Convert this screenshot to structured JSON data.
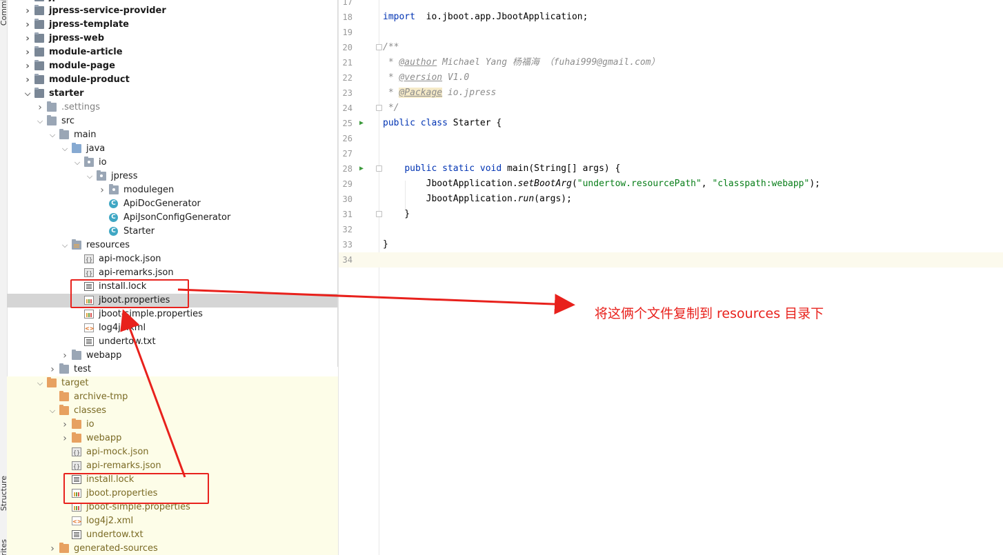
{
  "side_tabs": {
    "commit": "Commit",
    "structure": "Structure",
    "favorites": "Favorites"
  },
  "tree": [
    {
      "label": "jpress-service",
      "kind": "module",
      "icon": "module-folder-icon",
      "arrow": "right",
      "depth": 1
    },
    {
      "label": "jpress-service-provider",
      "kind": "module",
      "icon": "module-folder-icon",
      "arrow": "right",
      "depth": 1
    },
    {
      "label": "jpress-template",
      "kind": "module",
      "icon": "module-folder-icon",
      "arrow": "right",
      "depth": 1
    },
    {
      "label": "jpress-web",
      "kind": "module",
      "icon": "module-folder-icon",
      "arrow": "right",
      "depth": 1
    },
    {
      "label": "module-article",
      "kind": "module",
      "icon": "module-folder-icon",
      "arrow": "right",
      "depth": 1
    },
    {
      "label": "module-page",
      "kind": "module",
      "icon": "module-folder-icon",
      "arrow": "right",
      "depth": 1
    },
    {
      "label": "module-product",
      "kind": "module",
      "icon": "module-folder-icon",
      "arrow": "right",
      "depth": 1
    },
    {
      "label": "starter",
      "kind": "module",
      "icon": "module-folder-icon",
      "arrow": "down",
      "depth": 1
    },
    {
      "label": ".settings",
      "kind": "dim",
      "icon": "folder-icon",
      "arrow": "right",
      "depth": 2
    },
    {
      "label": "src",
      "kind": "normal",
      "icon": "folder-icon",
      "arrow": "down",
      "depth": 2
    },
    {
      "label": "main",
      "kind": "normal",
      "icon": "folder-icon",
      "arrow": "down",
      "depth": 3
    },
    {
      "label": "java",
      "kind": "normal",
      "icon": "source-folder-icon",
      "arrow": "down",
      "depth": 4
    },
    {
      "label": "io",
      "kind": "normal",
      "icon": "package-icon",
      "arrow": "down",
      "depth": 5
    },
    {
      "label": "jpress",
      "kind": "normal",
      "icon": "package-icon",
      "arrow": "down",
      "depth": 6
    },
    {
      "label": "modulegen",
      "kind": "normal",
      "icon": "package-icon",
      "arrow": "right",
      "depth": 7
    },
    {
      "label": "ApiDocGenerator",
      "kind": "normal",
      "icon": "class-icon",
      "arrow": "",
      "depth": 7
    },
    {
      "label": "ApiJsonConfigGenerator",
      "kind": "normal",
      "icon": "class-icon",
      "arrow": "",
      "depth": 7
    },
    {
      "label": "Starter",
      "kind": "normal",
      "icon": "class-icon",
      "arrow": "",
      "depth": 7
    },
    {
      "label": "resources",
      "kind": "normal",
      "icon": "resources-folder-icon",
      "arrow": "down",
      "depth": 4
    },
    {
      "label": "api-mock.json",
      "kind": "normal",
      "icon": "json-file-icon",
      "arrow": "",
      "depth": 5
    },
    {
      "label": "api-remarks.json",
      "kind": "normal",
      "icon": "json-file-icon",
      "arrow": "",
      "depth": 5
    },
    {
      "label": "install.lock",
      "kind": "normal",
      "icon": "text-file-icon",
      "arrow": "",
      "depth": 5
    },
    {
      "label": "jboot.properties",
      "kind": "selected",
      "icon": "properties-file-icon",
      "arrow": "",
      "depth": 5
    },
    {
      "label": "jboot-simple.properties",
      "kind": "normal",
      "icon": "properties-file-icon",
      "arrow": "",
      "depth": 5
    },
    {
      "label": "log4j2.xml",
      "kind": "normal",
      "icon": "xml-file-icon",
      "arrow": "",
      "depth": 5
    },
    {
      "label": "undertow.txt",
      "kind": "normal",
      "icon": "text-file-icon",
      "arrow": "",
      "depth": 5
    },
    {
      "label": "webapp",
      "kind": "normal",
      "icon": "folder-icon",
      "arrow": "right",
      "depth": 4
    },
    {
      "label": "test",
      "kind": "normal",
      "icon": "folder-icon",
      "arrow": "right",
      "depth": 3
    },
    {
      "label": "target",
      "kind": "excluded",
      "icon": "excluded-folder-icon",
      "arrow": "down",
      "depth": 2
    },
    {
      "label": "archive-tmp",
      "kind": "excluded",
      "icon": "excluded-folder-icon",
      "arrow": "",
      "depth": 3
    },
    {
      "label": "classes",
      "kind": "excluded",
      "icon": "excluded-folder-icon",
      "arrow": "down",
      "depth": 3
    },
    {
      "label": "io",
      "kind": "excluded",
      "icon": "excluded-folder-icon",
      "arrow": "right",
      "depth": 4
    },
    {
      "label": "webapp",
      "kind": "excluded",
      "icon": "excluded-folder-icon",
      "arrow": "right",
      "depth": 4
    },
    {
      "label": "api-mock.json",
      "kind": "excluded",
      "icon": "json-file-icon",
      "arrow": "",
      "depth": 4
    },
    {
      "label": "api-remarks.json",
      "kind": "excluded",
      "icon": "json-file-icon",
      "arrow": "",
      "depth": 4
    },
    {
      "label": "install.lock",
      "kind": "excluded",
      "icon": "text-file-icon",
      "arrow": "",
      "depth": 4
    },
    {
      "label": "jboot.properties",
      "kind": "excluded",
      "icon": "properties-file-icon",
      "arrow": "",
      "depth": 4
    },
    {
      "label": "jboot-simple.properties",
      "kind": "excluded",
      "icon": "properties-file-icon",
      "arrow": "",
      "depth": 4
    },
    {
      "label": "log4j2.xml",
      "kind": "excluded",
      "icon": "xml-file-icon",
      "arrow": "",
      "depth": 4
    },
    {
      "label": "undertow.txt",
      "kind": "excluded",
      "icon": "text-file-icon",
      "arrow": "",
      "depth": 4
    },
    {
      "label": "generated-sources",
      "kind": "excluded",
      "icon": "excluded-folder-icon",
      "arrow": "right",
      "depth": 3
    }
  ],
  "editor": {
    "lines": [
      {
        "n": "17",
        "segs": []
      },
      {
        "n": "18",
        "segs": [
          [
            "kw",
            "import"
          ],
          [
            "",
            "  io.jboot.app.JbootApplication;"
          ]
        ]
      },
      {
        "n": "19",
        "segs": []
      },
      {
        "n": "20",
        "segs": [
          [
            "cm",
            "/**"
          ]
        ],
        "fold": true
      },
      {
        "n": "21",
        "segs": [
          [
            "cm",
            " * "
          ],
          [
            "tag",
            "@author"
          ],
          [
            "cm",
            " Michael Yang 杨福海 （fuhai999@gmail.com）"
          ]
        ]
      },
      {
        "n": "22",
        "segs": [
          [
            "cm",
            " * "
          ],
          [
            "tag",
            "@version"
          ],
          [
            "cm",
            " V1.0"
          ]
        ]
      },
      {
        "n": "23",
        "segs": [
          [
            "cm",
            " * "
          ],
          [
            "tag-hl",
            "@Package"
          ],
          [
            "cm",
            " io.jpress"
          ]
        ]
      },
      {
        "n": "24",
        "segs": [
          [
            "cm",
            " */"
          ]
        ],
        "fold": true
      },
      {
        "n": "25",
        "segs": [
          [
            "kw",
            "public class"
          ],
          [
            "",
            " Starter {"
          ]
        ],
        "run": true
      },
      {
        "n": "26",
        "segs": []
      },
      {
        "n": "27",
        "segs": []
      },
      {
        "n": "28",
        "segs": [
          [
            "",
            "    "
          ],
          [
            "kw",
            "public static void"
          ],
          [
            "",
            " main(String[] args) {"
          ]
        ],
        "run": true,
        "fold": true
      },
      {
        "n": "29",
        "segs": [
          [
            "",
            "        JbootApplication."
          ],
          [
            "it",
            "setBootArg"
          ],
          [
            "",
            "("
          ],
          [
            "str",
            "\"undertow.resourcePath\""
          ],
          [
            "",
            ", "
          ],
          [
            "str",
            "\"classpath:webapp\""
          ],
          [
            "",
            ");"
          ]
        ]
      },
      {
        "n": "30",
        "segs": [
          [
            "",
            "        JbootApplication."
          ],
          [
            "it",
            "run"
          ],
          [
            "",
            "(args);"
          ]
        ]
      },
      {
        "n": "31",
        "segs": [
          [
            "",
            "    }"
          ]
        ],
        "fold": true
      },
      {
        "n": "32",
        "segs": []
      },
      {
        "n": "33",
        "segs": [
          [
            "",
            "}"
          ]
        ]
      },
      {
        "n": "34",
        "segs": [],
        "current": true
      }
    ]
  },
  "annotation": {
    "text": "将这俩个文件复制到 resources 目录下",
    "color": "#e8211c"
  }
}
